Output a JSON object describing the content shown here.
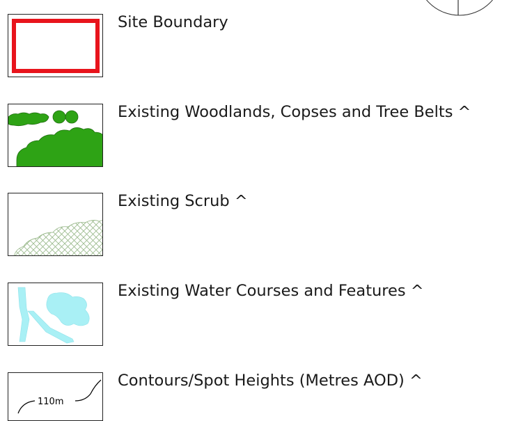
{
  "legend": {
    "items": [
      {
        "label": "Site Boundary",
        "swatch": "site-boundary",
        "color": "#e8141c"
      },
      {
        "label": "Existing Woodlands, Copses and Tree Belts ^",
        "swatch": "woodland",
        "color": "#2ea315"
      },
      {
        "label": "Existing Scrub ^",
        "swatch": "scrub",
        "color": "#9dbb8f"
      },
      {
        "label": "Existing Water Courses and Features  ^",
        "swatch": "water",
        "color": "#a9f0f5"
      },
      {
        "label": "Contours/Spot Heights (Metres AOD) ^",
        "swatch": "contours",
        "color": "#000000",
        "sample_value": "110m"
      }
    ]
  }
}
